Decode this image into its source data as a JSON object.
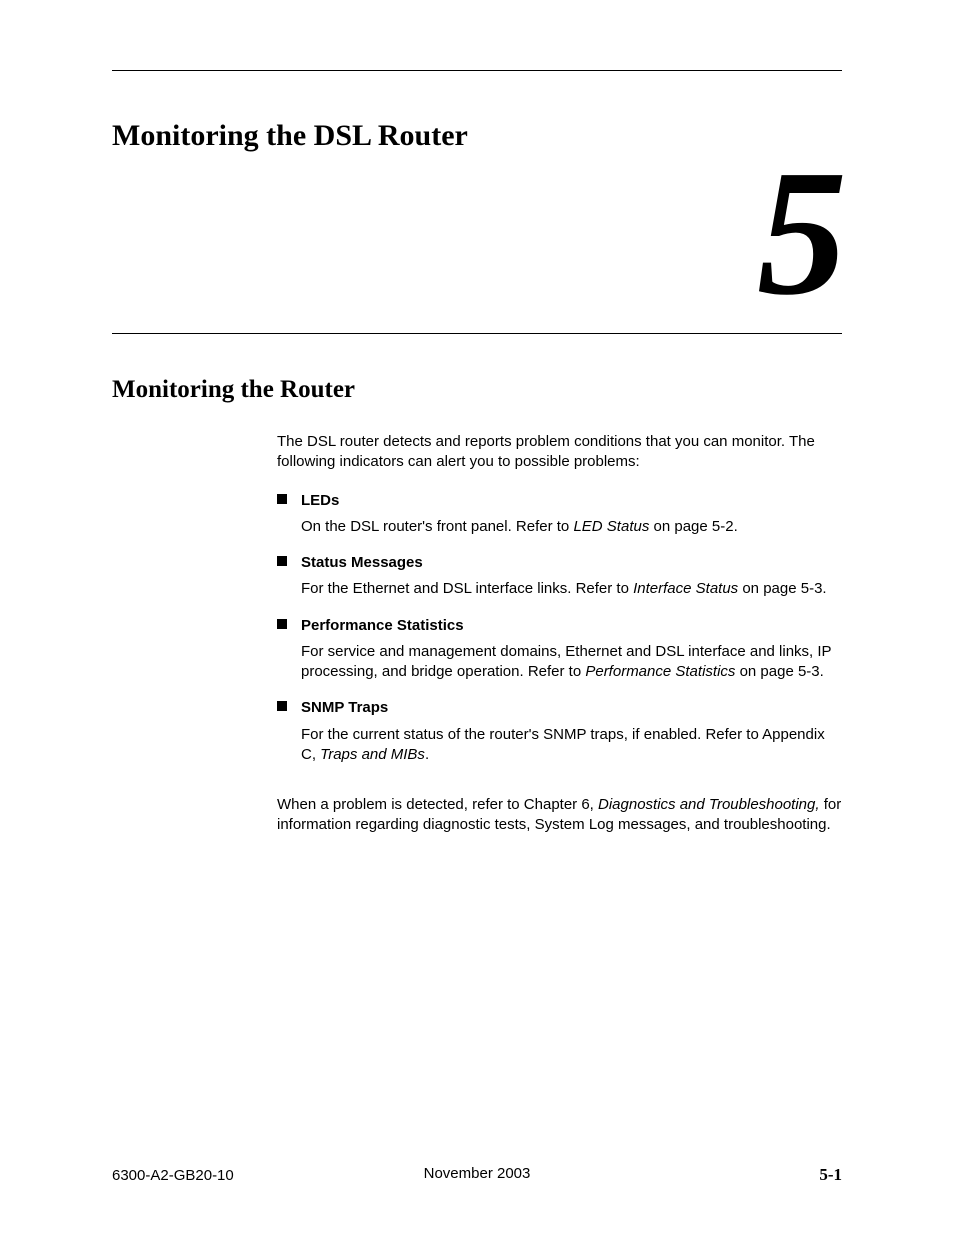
{
  "chapter": {
    "title": "Monitoring the DSL Router",
    "number": "5"
  },
  "section": {
    "title": "Monitoring the Router",
    "intro": "The DSL router detects and reports problem conditions that you can monitor. The following indicators can alert you to possible problems:",
    "items": [
      {
        "title": "LEDs",
        "body_pre": "On the DSL router's front panel. Refer to ",
        "xref": "LED Status",
        "body_post": " on page 5-2."
      },
      {
        "title": "Status Messages",
        "body_pre": "For the Ethernet and DSL interface links. Refer to ",
        "xref": "Interface Status",
        "body_post": " on page 5-3."
      },
      {
        "title": "Performance Statistics",
        "body_pre": "For service and management domains, Ethernet and DSL interface and links, IP processing, and bridge operation. Refer to ",
        "xref": "Performance Statistics",
        "body_post": " on page 5-3."
      },
      {
        "title": "SNMP Traps",
        "body_pre": "For the current status of the router's SNMP traps, if enabled. Refer to Appendix C, ",
        "xref": "Traps and MIBs",
        "body_post": "."
      }
    ],
    "closing_pre": "When a problem is detected, refer to ",
    "closing_chapter": "Chapter 6,",
    "closing_xref": "Diagnostics and Troubleshooting,",
    "closing_post": " for information regarding diagnostic tests, System Log messages, and troubleshooting."
  },
  "footer": {
    "left": "6300-A2-GB20-10",
    "center": "November 2003",
    "right": "5-1"
  }
}
